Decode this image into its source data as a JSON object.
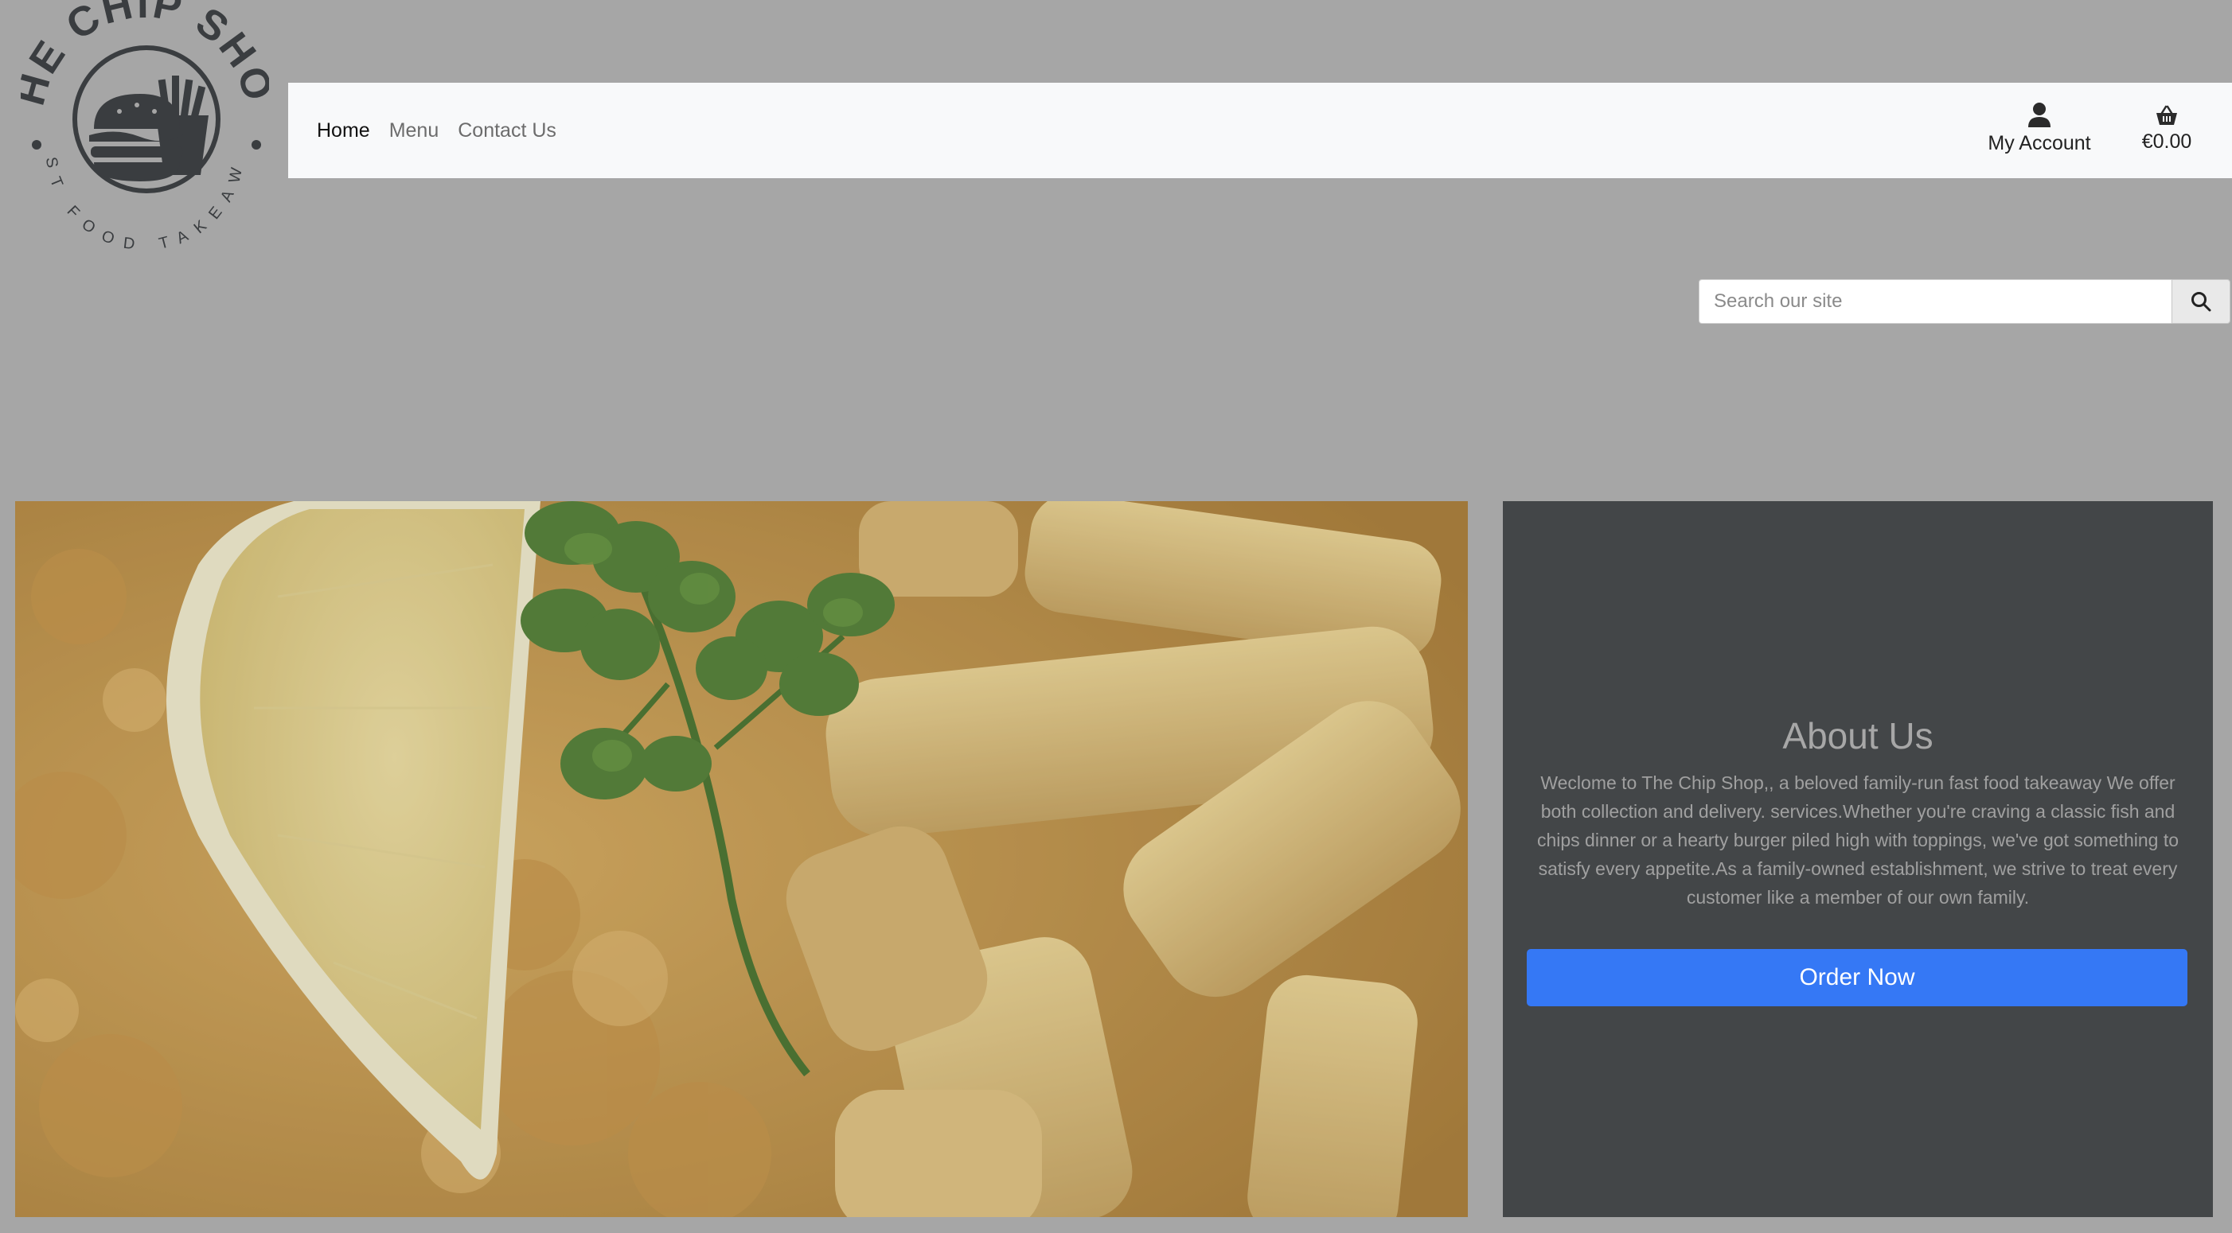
{
  "brand": {
    "name_arc": "THE CHIP SHOP",
    "tagline_arc": "FAST FOOD TAKEAWAY"
  },
  "nav": {
    "links": [
      {
        "label": "Home",
        "active": true
      },
      {
        "label": "Menu",
        "active": false
      },
      {
        "label": "Contact Us",
        "active": false
      }
    ],
    "account_label": "My Account",
    "account_icon": "user-icon",
    "cart_total": "€0.00",
    "cart_icon": "basket-icon"
  },
  "search": {
    "placeholder": "Search our site",
    "value": "",
    "icon": "search-icon"
  },
  "hero": {
    "image_desc": "fish-and-chips-with-lemon-and-parsley"
  },
  "about": {
    "title": "About Us",
    "text": "Weclome to The Chip Shop,, a beloved family-run fast food takeaway We offer both collection and delivery. services.Whether you're craving a classic fish and chips dinner or a hearty burger piled high with toppings, we've got something to satisfy every appetite.As a family-owned establishment, we strive to treat every customer like a member of our own family.",
    "button_label": "Order Now"
  },
  "colors": {
    "page_bg": "#a6a6a6",
    "navbar_bg": "#f8f9fa",
    "about_bg": "#434648",
    "primary_button": "#3578f5",
    "logo_ink": "#3a3d40"
  }
}
